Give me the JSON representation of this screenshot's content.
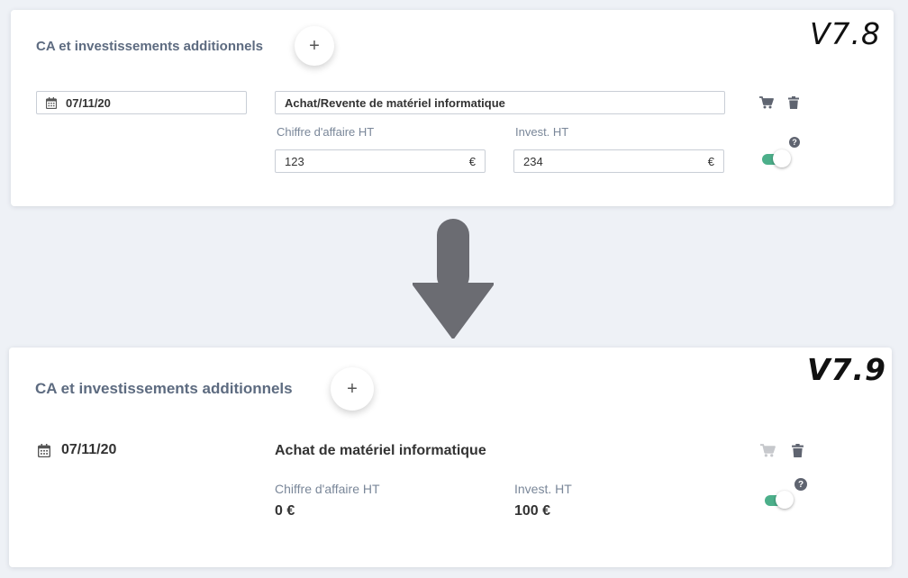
{
  "before": {
    "version": "V7.8",
    "section_title": "CA et investissements additionnels",
    "add_label": "+",
    "date": "07/11/20",
    "name": "Achat/Revente de matériel informatique",
    "ca_label": "Chiffre d'affaire HT",
    "ca_value": "123",
    "invest_label": "Invest. HT",
    "invest_value": "234",
    "currency": "€",
    "help": "?",
    "toggle_on": true
  },
  "after": {
    "version": "V7.9",
    "section_title": "CA et investissements additionnels",
    "add_label": "+",
    "date": "07/11/20",
    "name": "Achat de matériel informatique",
    "ca_label": "Chiffre d'affaire HT",
    "ca_value": "0 €",
    "invest_label": "Invest. HT",
    "invest_value": "100 €",
    "help": "?",
    "toggle_on": true
  },
  "colors": {
    "toggle_on": "#4caf8a",
    "title_text": "#5d6b80",
    "arrow": "#6b6c72"
  },
  "icons": [
    "calendar-icon",
    "cart-icon",
    "trash-icon",
    "help-icon",
    "plus-icon",
    "arrow-down-icon"
  ]
}
